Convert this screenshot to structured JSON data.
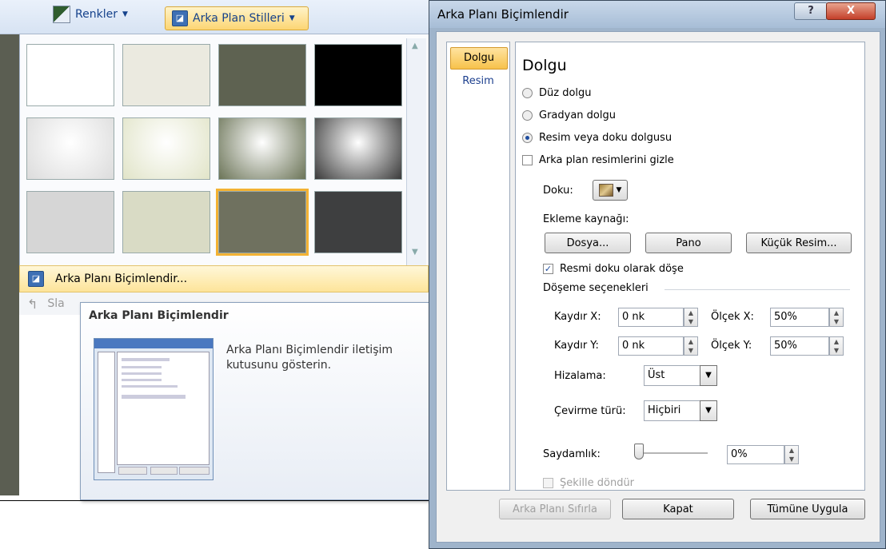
{
  "ribbon": {
    "colors_label": "Renkler",
    "bg_styles_label": "Arka Plan Stilleri"
  },
  "gallery": {
    "tile_colors": [
      "#ffffff",
      "#ebeae0",
      "#5e6251",
      "#000000",
      "#dcdcdc",
      "#e1e4c8",
      "#6b7457",
      "#3a3a3a",
      "#d6d6d6",
      "#d9dbc5",
      "#6f715f",
      "#3e3f40"
    ],
    "selected_index": 10
  },
  "menu": {
    "format_label": "Arka Planı Biçimlendir...",
    "slayt_label": "Sla"
  },
  "tooltip": {
    "title": "Arka Planı Biçimlendir",
    "description": "Arka Planı Biçimlendir iletişim kutusunu gösterin."
  },
  "dialog": {
    "title": "Arka Planı Biçimlendir",
    "help": "?",
    "close": "X",
    "nav": [
      "Dolgu",
      "Resim"
    ],
    "heading": "Dolgu",
    "radio_solid": "Düz dolgu",
    "radio_gradient": "Gradyan dolgu",
    "radio_picture": "Resim veya doku dolgusu",
    "chk_hide": "Arka plan resimlerini gizle",
    "texture_label": "Doku:",
    "insert_from": "Ekleme kaynağı:",
    "btn_file": "Dosya...",
    "btn_clipboard": "Pano",
    "btn_clipart": "Küçük Resim...",
    "chk_tile": "Resmi doku olarak döşe",
    "tile_options": "Döşeme seçenekleri",
    "offset_x_label": "Kaydır X:",
    "offset_x": "0 nk",
    "scale_x_label": "Ölçek X:",
    "scale_x": "50%",
    "offset_y_label": "Kaydır Y:",
    "offset_y": "0 nk",
    "scale_y_label": "Ölçek Y:",
    "scale_y": "50%",
    "align_label": "Hizalama:",
    "align_value": "Üst",
    "mirror_label": "Çevirme türü:",
    "mirror_value": "Hiçbiri",
    "transparency_label": "Saydamlık:",
    "transparency_value": "0%",
    "transparency_level": 0,
    "chk_rotate": "Şekille döndür",
    "btn_reset": "Arka Planı Sıfırla",
    "btn_close": "Kapat",
    "btn_apply_all": "Tümüne Uygula"
  }
}
